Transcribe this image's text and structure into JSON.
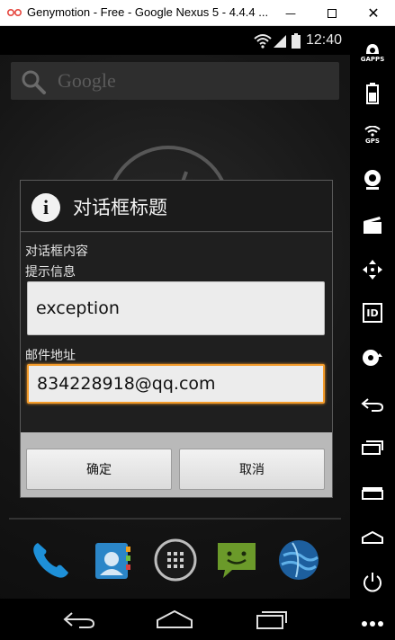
{
  "window": {
    "title": "Genymotion - Free - Google Nexus 5 - 4.4.4 ...",
    "minimize_glyph": "—",
    "close_glyph": "✕"
  },
  "statusbar": {
    "time": "12:40"
  },
  "home": {
    "search_placeholder": "Google"
  },
  "dialog": {
    "icon_glyph": "i",
    "title": "对话框标题",
    "content": "对话框内容",
    "field1_label": "提示信息",
    "field1_value": "exception",
    "field2_label": "邮件地址",
    "field2_value": "834228918@qq.com",
    "ok_label": "确定",
    "cancel_label": "取消"
  },
  "sidebar": {
    "gapps_label": "GAPPS",
    "gps_label": "GPS",
    "id_label": "ID"
  },
  "colors": {
    "focus_accent": "#f39b2a",
    "dialog_header": "#1b1b1b",
    "button_bar": "#b9b9b9"
  }
}
